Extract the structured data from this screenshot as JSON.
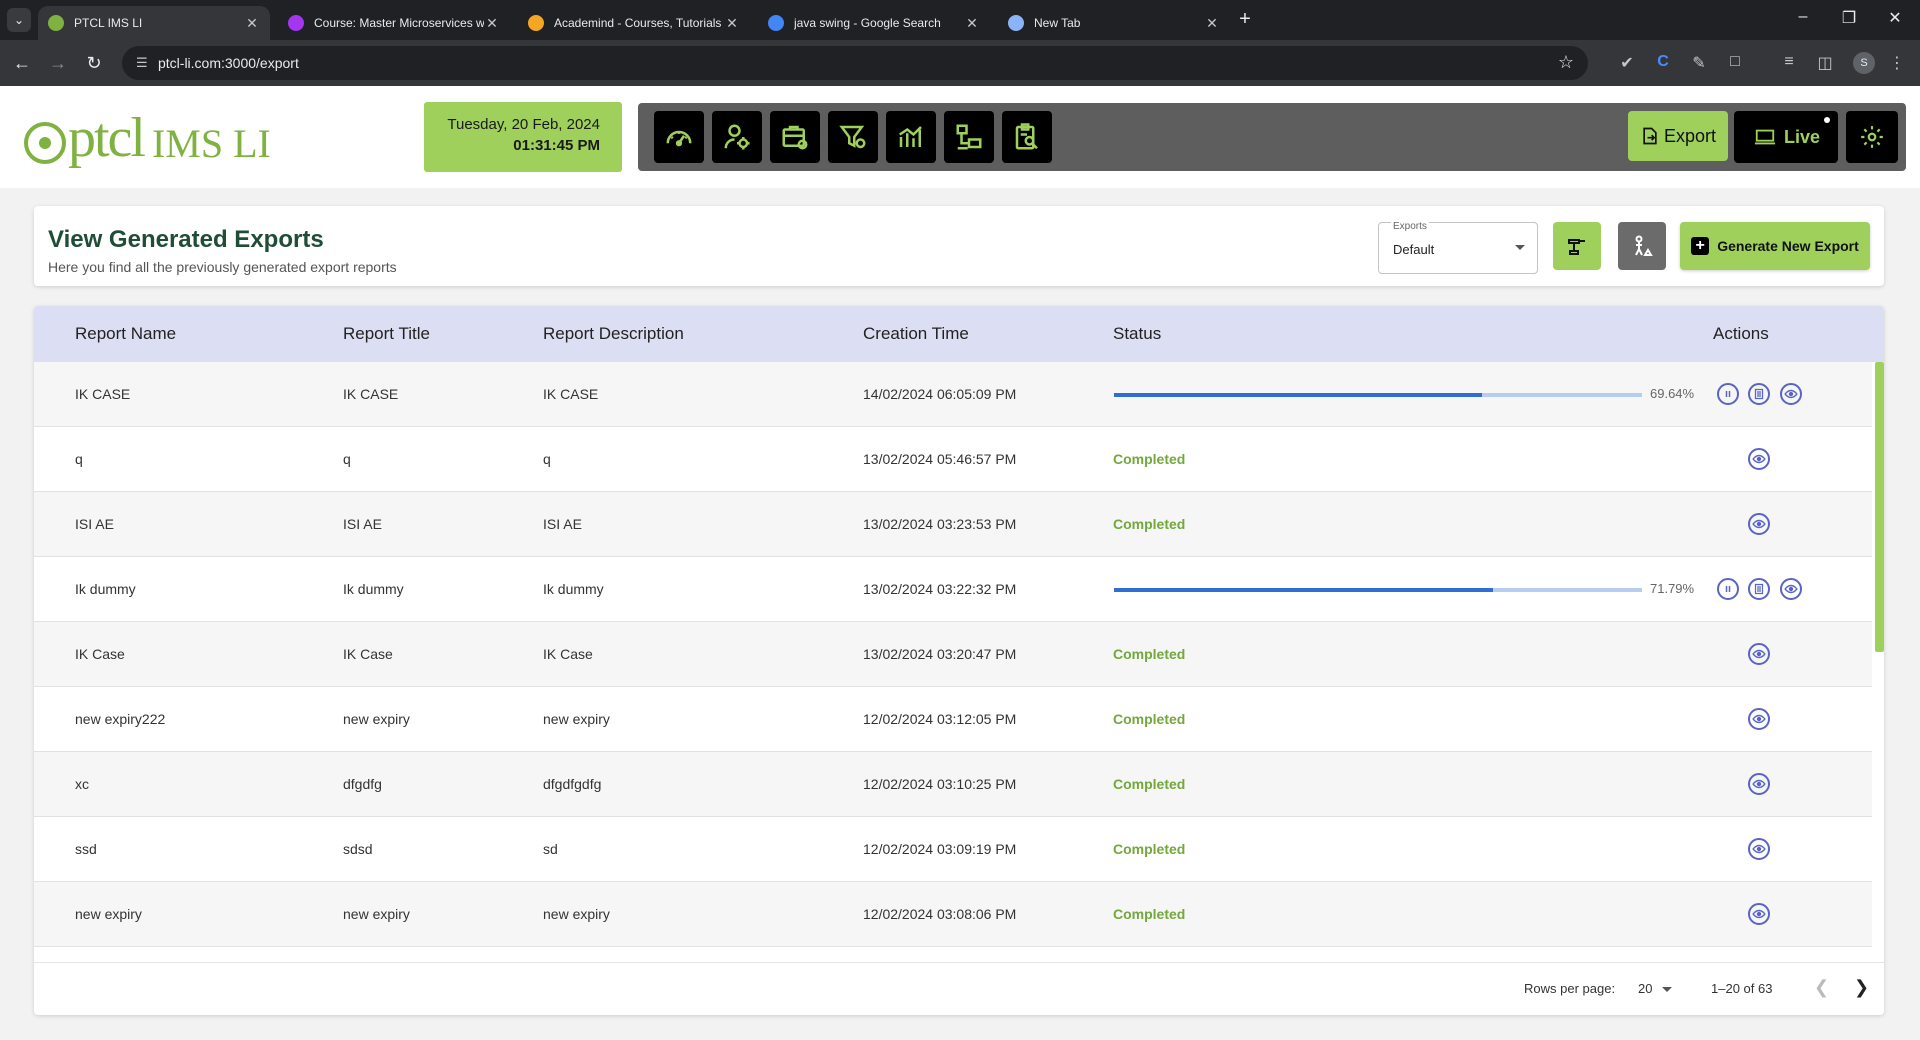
{
  "browser": {
    "tabs": [
      {
        "title": "PTCL IMS LI",
        "active": true,
        "favicon": "ptcl-favicon",
        "color": "#7fb241"
      },
      {
        "title": "Course: Master Microservices w",
        "active": false,
        "favicon": "udemy-favicon",
        "color": "#a435f0"
      },
      {
        "title": "Academind - Courses, Tutorials",
        "active": false,
        "favicon": "academind-favicon",
        "color": "#f5a623"
      },
      {
        "title": "java swing - Google Search",
        "active": false,
        "favicon": "google-favicon",
        "color": "#4285f4"
      },
      {
        "title": "New Tab",
        "active": false,
        "favicon": "chrome-favicon",
        "color": "#8ab4f8"
      }
    ],
    "url": "ptcl-li.com:3000/export",
    "profile_initial": "S"
  },
  "header": {
    "logo_ptcl": "ptcl",
    "logo_ims": "IMS LI",
    "date": "Tuesday, 20 Feb, 2024",
    "time": "01:31:45 PM",
    "nav_icons": [
      "dashboard-gauge-icon",
      "user-settings-icon",
      "case-settings-icon",
      "filter-settings-icon",
      "analytics-chart-icon",
      "network-devices-icon",
      "report-search-icon"
    ],
    "export_label": "Export",
    "live_label": "Live"
  },
  "page": {
    "title": "View Generated Exports",
    "subtitle": "Here you find all the previously generated export reports",
    "select_label": "Exports",
    "select_value": "Default",
    "generate_label": "Generate New Export"
  },
  "table": {
    "columns": [
      "Report Name",
      "Report Title",
      "Report Description",
      "Creation Time",
      "Status",
      "Actions"
    ],
    "rows": [
      {
        "name": "IK CASE",
        "title": "IK CASE",
        "description": "IK CASE",
        "time": "14/02/2024 06:05:09 PM",
        "status": "progress",
        "progress": 69.64,
        "progress_label": "69.64%"
      },
      {
        "name": "q",
        "title": "q",
        "description": "q",
        "time": "13/02/2024 05:46:57 PM",
        "status": "Completed"
      },
      {
        "name": "ISI AE",
        "title": "ISI AE",
        "description": "ISI AE",
        "time": "13/02/2024 03:23:53 PM",
        "status": "Completed"
      },
      {
        "name": "Ik dummy",
        "title": "Ik dummy",
        "description": "Ik dummy",
        "time": "13/02/2024 03:22:32 PM",
        "status": "progress",
        "progress": 71.79,
        "progress_label": "71.79%"
      },
      {
        "name": "IK Case",
        "title": "IK Case",
        "description": "IK Case",
        "time": "13/02/2024 03:20:47 PM",
        "status": "Completed"
      },
      {
        "name": "new expiry222",
        "title": "new expiry",
        "description": "new expiry",
        "time": "12/02/2024 03:12:05 PM",
        "status": "Completed"
      },
      {
        "name": "xc",
        "title": "dfgdfg",
        "description": "dfgdfgdfg",
        "time": "12/02/2024 03:10:25 PM",
        "status": "Completed"
      },
      {
        "name": "ssd",
        "title": "sdsd",
        "description": "sd",
        "time": "12/02/2024 03:09:19 PM",
        "status": "Completed"
      },
      {
        "name": "new expiry",
        "title": "new expiry",
        "description": "new expiry",
        "time": "12/02/2024 03:08:06 PM",
        "status": "Completed"
      }
    ],
    "footer": {
      "rows_per_page_label": "Rows per page:",
      "rows_per_page": "20",
      "range": "1–20 of 63"
    }
  },
  "colors": {
    "accent_green": "#9fd05b",
    "completed_green": "#72a83c",
    "title_green": "#1f4d38",
    "progress_blue": "#2f6fd1",
    "action_icon": "#5964c4",
    "header_row": "#dcdff3"
  }
}
